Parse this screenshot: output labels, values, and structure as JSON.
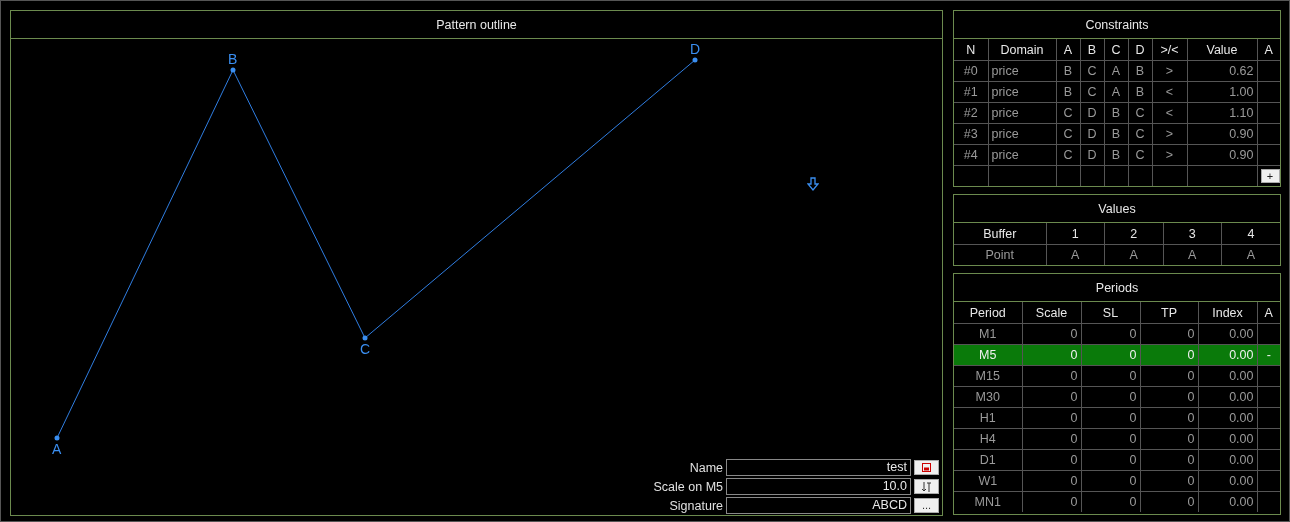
{
  "pattern": {
    "title": "Pattern outline",
    "points": [
      {
        "label": "A"
      },
      {
        "label": "B"
      },
      {
        "label": "C"
      },
      {
        "label": "D"
      }
    ]
  },
  "form": {
    "fields": [
      {
        "label": "Name",
        "value": "test",
        "kind": "save"
      },
      {
        "label": "Scale on M5",
        "value": "10.0",
        "kind": "sort"
      },
      {
        "label": "Signature",
        "value": "ABCD",
        "kind": "more",
        "button_text": "..."
      }
    ]
  },
  "constraints": {
    "title": "Constraints",
    "columns": [
      "N",
      "Domain",
      "A",
      "B",
      "C",
      "D",
      ">/<",
      "Value",
      "A"
    ],
    "rows": [
      {
        "cells": [
          "#0",
          "price",
          "B",
          "C",
          "A",
          "B",
          ">",
          "0.62"
        ]
      },
      {
        "cells": [
          "#1",
          "price",
          "B",
          "C",
          "A",
          "B",
          "<",
          "1.00"
        ]
      },
      {
        "cells": [
          "#2",
          "price",
          "C",
          "D",
          "B",
          "C",
          "<",
          "1.10"
        ]
      },
      {
        "cells": [
          "#3",
          "price",
          "C",
          "D",
          "B",
          "C",
          ">",
          "0.90"
        ]
      },
      {
        "cells": [
          "#4",
          "price",
          "C",
          "D",
          "B",
          "C",
          ">",
          "0.90"
        ]
      }
    ],
    "add_button": "+"
  },
  "values": {
    "title": "Values",
    "columns": [
      "Buffer",
      "1",
      "2",
      "3",
      "4"
    ],
    "row": [
      "Point",
      "A",
      "A",
      "A",
      "A"
    ]
  },
  "periods": {
    "title": "Periods",
    "columns": [
      "Period",
      "Scale",
      "SL",
      "TP",
      "Index",
      "A"
    ],
    "rows": [
      {
        "cells": [
          "M1",
          "0",
          "0",
          "0",
          "0.00"
        ],
        "selected": false
      },
      {
        "cells": [
          "M5",
          "0",
          "0",
          "0",
          "0.00"
        ],
        "selected": true,
        "mark": "-"
      },
      {
        "cells": [
          "M15",
          "0",
          "0",
          "0",
          "0.00"
        ],
        "selected": false
      },
      {
        "cells": [
          "M30",
          "0",
          "0",
          "0",
          "0.00"
        ],
        "selected": false
      },
      {
        "cells": [
          "H1",
          "0",
          "0",
          "0",
          "0.00"
        ],
        "selected": false
      },
      {
        "cells": [
          "H4",
          "0",
          "0",
          "0",
          "0.00"
        ],
        "selected": false
      },
      {
        "cells": [
          "D1",
          "0",
          "0",
          "0",
          "0.00"
        ],
        "selected": false
      },
      {
        "cells": [
          "W1",
          "0",
          "0",
          "0",
          "0.00"
        ],
        "selected": false
      },
      {
        "cells": [
          "MN1",
          "0",
          "0",
          "0",
          "0.00"
        ],
        "selected": false
      }
    ]
  }
}
